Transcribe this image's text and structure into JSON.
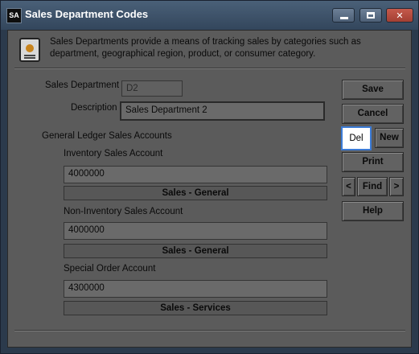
{
  "window": {
    "app_icon_text": "SA",
    "title": "Sales Department Codes"
  },
  "info": {
    "text": "Sales Departments provide a means of tracking sales by categories such as department, geographical region, product, or consumer category."
  },
  "form": {
    "sales_department_label": "Sales Department",
    "sales_department_value": "D2",
    "description_label": "Description",
    "description_value": "Sales Department 2",
    "gl_heading": "General Ledger Sales Accounts",
    "inventory_label": "Inventory Sales Account",
    "inventory_value": "4000000",
    "inventory_name": "Sales - General",
    "non_inventory_label": "Non-Inventory Sales Account",
    "non_inventory_value": "4000000",
    "non_inventory_name": "Sales - General",
    "special_order_label": "Special Order Account",
    "special_order_value": "4300000",
    "special_order_name": "Sales - Services"
  },
  "buttons": {
    "save": "Save",
    "cancel": "Cancel",
    "del": "Del",
    "new": "New",
    "print": "Print",
    "prev": "<",
    "find": "Find",
    "next": ">",
    "help": "Help"
  },
  "titlebar_buttons": {
    "close": "✕"
  }
}
